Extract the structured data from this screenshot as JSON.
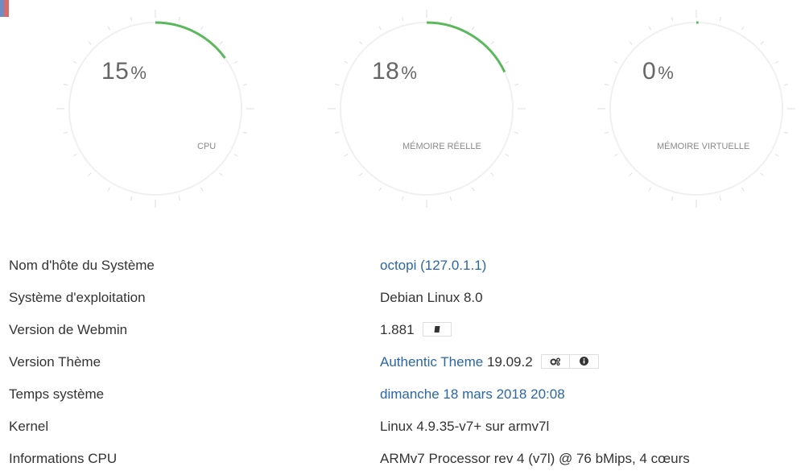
{
  "gauges": [
    {
      "label": "CPU",
      "value": 15,
      "unit": "%"
    },
    {
      "label": "MÉMOIRE RÉELLE",
      "value": 18,
      "unit": "%"
    },
    {
      "label": "MÉMOIRE VIRTUELLE",
      "value": 0,
      "unit": "%"
    }
  ],
  "colors": {
    "gauge_fill": "#5cb85c",
    "gauge_track": "#f0f0f0",
    "link": "#2a66a8"
  },
  "info": {
    "hostname": {
      "label": "Nom d'hôte du Système",
      "value": "octopi (127.0.1.1)"
    },
    "os": {
      "label": "Système d'exploitation",
      "value": "Debian Linux 8.0"
    },
    "webmin": {
      "label": "Version de Webmin",
      "value": "1.881",
      "button_icon": "book-icon"
    },
    "theme": {
      "label": "Version Thème",
      "link_text": "Authentic Theme",
      "version": "19.09.2",
      "button_icons": [
        "cogs-icon",
        "info-icon"
      ]
    },
    "time": {
      "label": "Temps système",
      "value": "dimanche 18 mars 2018 20:08"
    },
    "kernel": {
      "label": "Kernel",
      "value": "Linux 4.9.35-v7+ sur armv7l"
    },
    "cpu": {
      "label": "Informations CPU",
      "value": "ARMv7 Processor rev 4 (v7l) @ 76 bMips, 4 cœurs"
    }
  }
}
